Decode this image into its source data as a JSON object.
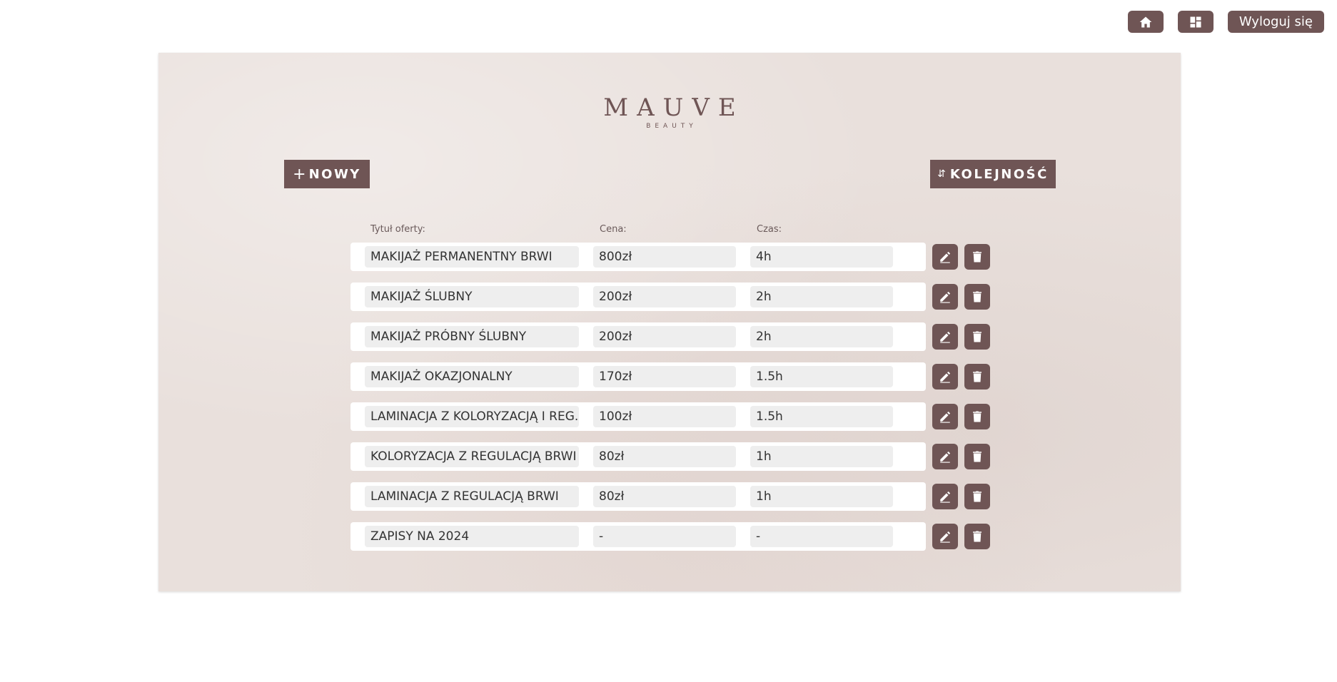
{
  "topbar": {
    "home_icon": "home-icon",
    "dashboard_icon": "dashboard-icon",
    "logout_label": "Wyloguj się"
  },
  "logo": {
    "main": "MAUVE",
    "sub": "BEAUTY"
  },
  "actions": {
    "new_label": "NOWY",
    "new_icon": "plus-icon",
    "order_label": "KOLEJNOŚĆ",
    "order_icon": "sort-arrows-icon"
  },
  "table": {
    "headers": {
      "title": "Tytuł oferty:",
      "price": "Cena:",
      "time": "Czas:"
    },
    "rows": [
      {
        "title": "MAKIJAŻ PERMANENTNY BRWI",
        "price": "800zł",
        "time": "4h"
      },
      {
        "title": "MAKIJAŻ ŚLUBNY",
        "price": "200zł",
        "time": "2h"
      },
      {
        "title": "MAKIJAŻ PRÓBNY ŚLUBNY",
        "price": "200zł",
        "time": "2h"
      },
      {
        "title": "MAKIJAŻ OKAZJONALNY",
        "price": "170zł",
        "time": "1.5h"
      },
      {
        "title": "LAMINACJA Z KOLORYZACJĄ I REG...",
        "price": "100zł",
        "time": "1.5h"
      },
      {
        "title": "KOLORYZACJA Z REGULACJĄ BRWI",
        "price": "80zł",
        "time": "1h"
      },
      {
        "title": "LAMINACJA Z REGULACJĄ BRWI",
        "price": "80zł",
        "time": "1h"
      },
      {
        "title": "ZAPISY NA 2024",
        "price": "-",
        "time": "-"
      }
    ],
    "row_edit_icon": "pencil-icon",
    "row_delete_icon": "trash-icon"
  },
  "colors": {
    "accent": "#6f5555",
    "panel_bg": "#e9e0dc",
    "field_bg": "#eeeeee"
  }
}
